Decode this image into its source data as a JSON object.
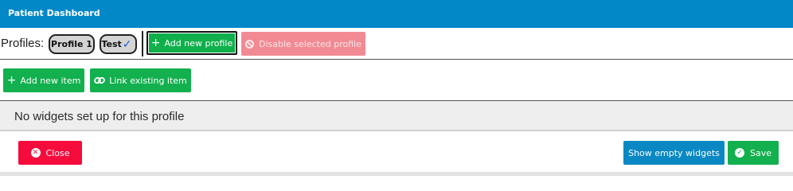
{
  "header": {
    "title": "Patient Dashboard"
  },
  "profiles": {
    "label": "Profiles:",
    "items": [
      {
        "label": "Profile 1",
        "selected": false
      },
      {
        "label": "Test",
        "selected": true
      }
    ],
    "add_label": "Add new profile",
    "disable_label": "Disable selected profile"
  },
  "items_toolbar": {
    "add_label": "Add new item",
    "link_label": "Link existing item"
  },
  "main": {
    "empty_message": "No widgets set up for this profile"
  },
  "footer": {
    "close_label": "Close",
    "show_empty_label": "Show empty widgets",
    "save_label": "Save"
  },
  "icons": {
    "plus": "plus-icon",
    "ban": "ban-icon",
    "link": "link-icon",
    "close": "close-circle-icon",
    "check": "check-circle-icon",
    "selected_check": "checkmark-icon"
  },
  "colors": {
    "header_bg": "#0288c7",
    "success": "#12b04e",
    "danger": "#f50c3c",
    "danger_disabled": "#f28a93",
    "info": "#0a88c4"
  }
}
